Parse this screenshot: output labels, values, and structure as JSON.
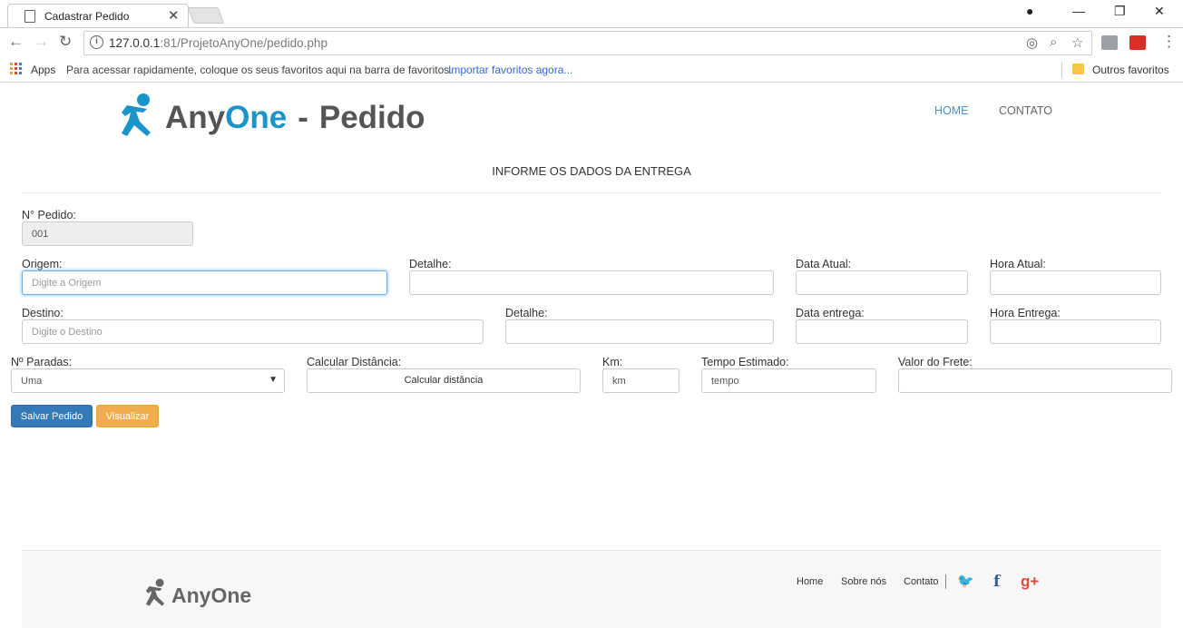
{
  "browser": {
    "tab_title": "Cadastrar Pedido",
    "tab_close": "✕",
    "url_host": "127.0.0.1",
    "url_rest": ":81/ProjetoAnyOne/pedido.php",
    "bookmarks": {
      "apps_label": "Apps",
      "hint": "Para acessar rapidamente, coloque os seus favoritos aqui na barra de favoritos.",
      "import_link": "Importar favoritos agora...",
      "other_label": "Outros favoritos"
    }
  },
  "header": {
    "brand_any": "Any",
    "brand_one": "One",
    "brand_dash": "-",
    "brand_page": "Pedido",
    "nav": [
      "HOME",
      "CONTATO"
    ]
  },
  "form": {
    "section_title": "INFORME OS DADOS DA ENTREGA",
    "pedido_label": "N° Pedido:",
    "pedido_value": "001",
    "origem_label": "Origem:",
    "origem_placeholder": "Digite a Origem",
    "detalhe1_label": "Detalhe:",
    "data_atual_label": "Data Atual:",
    "hora_atual_label": "Hora Atual:",
    "destino_label": "Destino:",
    "destino_placeholder": "Digite o Destino",
    "detalhe2_label": "Detalhe:",
    "data_entrega_label": "Data entrega:",
    "hora_entrega_label": "Hora Entrega:",
    "paradas_label": "Nº Paradas:",
    "paradas_value": "Uma",
    "calcular_label": "Calcular Distância:",
    "calcular_button": "Calcular distância",
    "km_label": "Km:",
    "km_value": "km",
    "tempo_label": "Tempo Estimado:",
    "tempo_value": "tempo",
    "frete_label": "Valor do Frete:",
    "salvar_button": "Salvar Pedido",
    "visualizar_button": "Visualizar"
  },
  "footer": {
    "brand": "AnyOne",
    "links": [
      "Home",
      "Sobre nós",
      "Contato"
    ],
    "social": [
      {
        "icon": "twitter-icon",
        "glyph": "🐦",
        "color": "#1da1f2"
      },
      {
        "icon": "facebook-icon",
        "glyph": "f",
        "color": "#3b5998"
      },
      {
        "icon": "google-plus-icon",
        "glyph": "g+",
        "color": "#dd4b39"
      }
    ]
  },
  "colors": {
    "brand_blue": "#1a94c9",
    "primary": "#337ab7",
    "warning": "#f0ad4e"
  }
}
